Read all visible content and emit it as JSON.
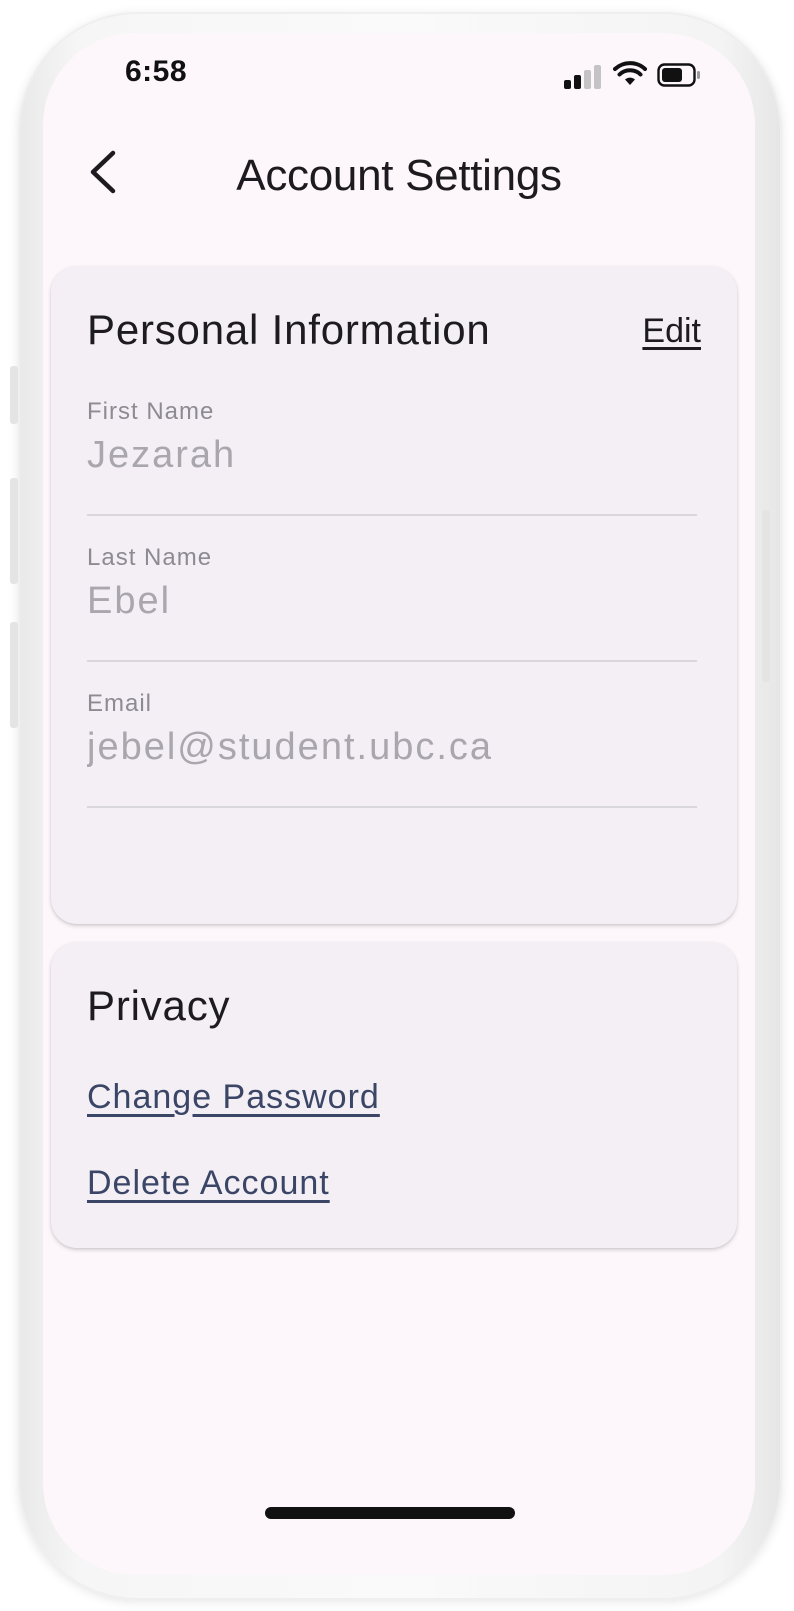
{
  "status_bar": {
    "time": "6:58",
    "signal_icon": "cellular-signal-icon",
    "wifi_icon": "wifi-icon",
    "battery_icon": "battery-icon",
    "signal_bars_active": 2,
    "signal_bars_total": 4,
    "battery_level": 0.6
  },
  "header": {
    "back_icon": "chevron-left-icon",
    "title": "Account Settings"
  },
  "personal_info": {
    "title": "Personal Information",
    "edit_label": "Edit",
    "fields": [
      {
        "label": "First Name",
        "value": "Jezarah"
      },
      {
        "label": "Last Name",
        "value": "Ebel"
      },
      {
        "label": "Email",
        "value": "jebel@student.ubc.ca"
      }
    ]
  },
  "privacy": {
    "title": "Privacy",
    "change_password_label": "Change Password",
    "delete_account_label": "Delete Account"
  },
  "colors": {
    "screen_background": "#fdf7fb",
    "card_background": "#f3eff5",
    "link_color": "#3b4566",
    "text_primary": "#1d1b20",
    "text_disabled": "#a9a6ad"
  }
}
